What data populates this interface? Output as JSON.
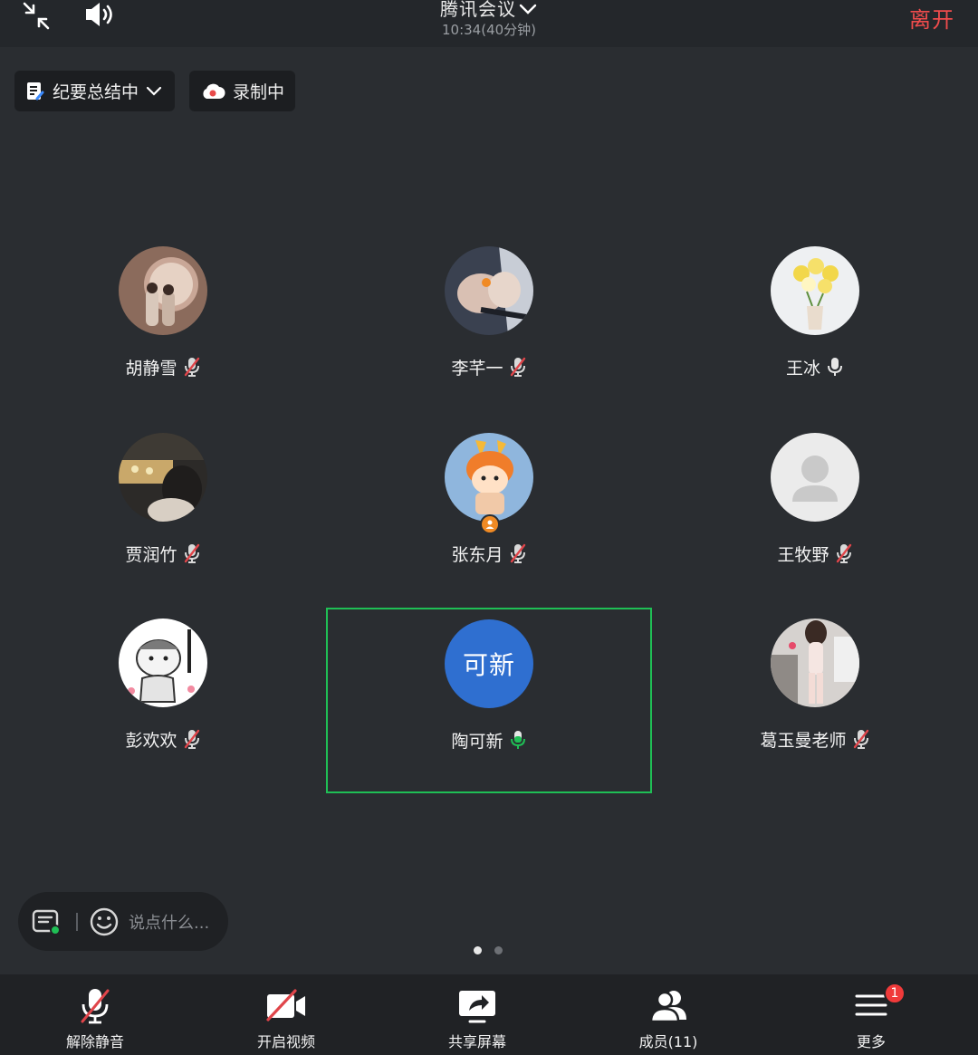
{
  "header": {
    "title": "腾讯会议",
    "time": "10:34(40分钟)",
    "leave_label": "离开"
  },
  "chips": {
    "summary_label": "纪要总结中",
    "record_label": "录制中"
  },
  "participants": [
    {
      "name": "胡静雪",
      "mic": "muted"
    },
    {
      "name": "李芊一",
      "mic": "muted"
    },
    {
      "name": "王冰",
      "mic": "on"
    },
    {
      "name": "贾润竹",
      "mic": "muted"
    },
    {
      "name": "张东月",
      "mic": "muted",
      "role": "host"
    },
    {
      "name": "王牧野",
      "mic": "muted"
    },
    {
      "name": "彭欢欢",
      "mic": "muted"
    },
    {
      "name": "陶可新",
      "mic": "speaking",
      "avatar_text": "可新",
      "active": true
    },
    {
      "name": "葛玉曼老师",
      "mic": "muted"
    }
  ],
  "chat": {
    "placeholder": "说点什么..."
  },
  "pagination": {
    "total": 2,
    "current": 1
  },
  "toolbar": {
    "unmute_label": "解除静音",
    "video_label": "开启视频",
    "share_label": "共享屏幕",
    "members_label": "成员(11)",
    "more_label": "更多",
    "more_badge": "1"
  },
  "colors": {
    "background": "#2a2d31",
    "leave": "#f04c4c",
    "active_border": "#1fbf55",
    "avatar_blue": "#2f6fd0",
    "muted_slash": "#e0454a",
    "speaking_mic": "#1fbf55"
  }
}
